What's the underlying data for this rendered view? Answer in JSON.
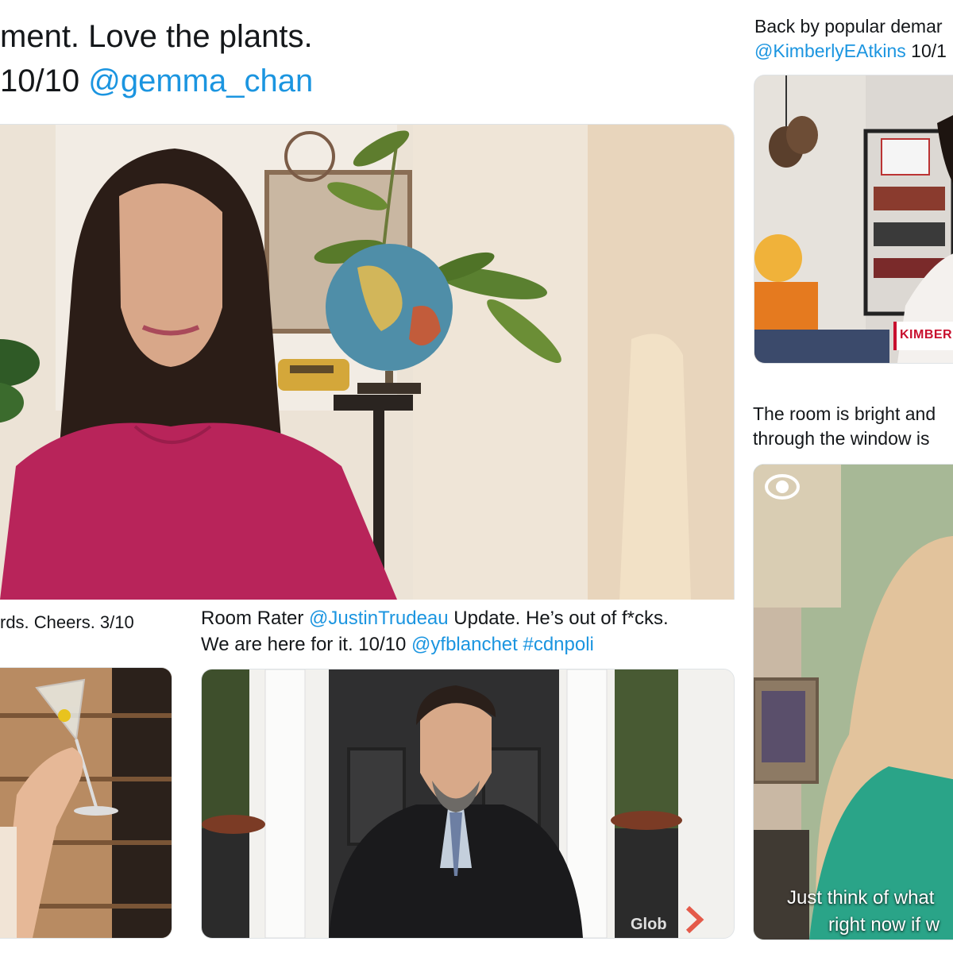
{
  "tweets": {
    "gemma": {
      "line1": "ment. Love the plants.",
      "line2_prefix": "10/10 ",
      "line2_handle": "@gemma_chan"
    },
    "kimberly": {
      "line1": "Back by popular demar",
      "line2_handle": "@KimberlyEAtkins",
      "line2_suffix": " 10/1",
      "lower_third": "KIMBER"
    },
    "room": {
      "line1": "The room is bright and",
      "line2": "through  the window is",
      "logo": "CBS",
      "caption_line1": "Just think of what",
      "caption_line2": "right now if w"
    },
    "cheers": {
      "line1": "rds. Cheers. 3/10"
    },
    "trudeau": {
      "line1_prefix": "Room Rater ",
      "line1_handle": "@JustinTrudeau",
      "line1_suffix": " Update. He’s out of f*cks.",
      "line2_prefix": "We are here for it. 10/10 ",
      "line2_handle": "@yfblanchet",
      "line2_hashtag": " #cdnpoli",
      "watermark": "Glob"
    }
  },
  "colors": {
    "link": "#1b95e0",
    "text": "#14171a",
    "shirt": "#b8245a",
    "lower_third_red": "#c8102e"
  },
  "icons": [
    "globe-icon",
    "cbs-eye-logo",
    "chevron-right-icon"
  ]
}
